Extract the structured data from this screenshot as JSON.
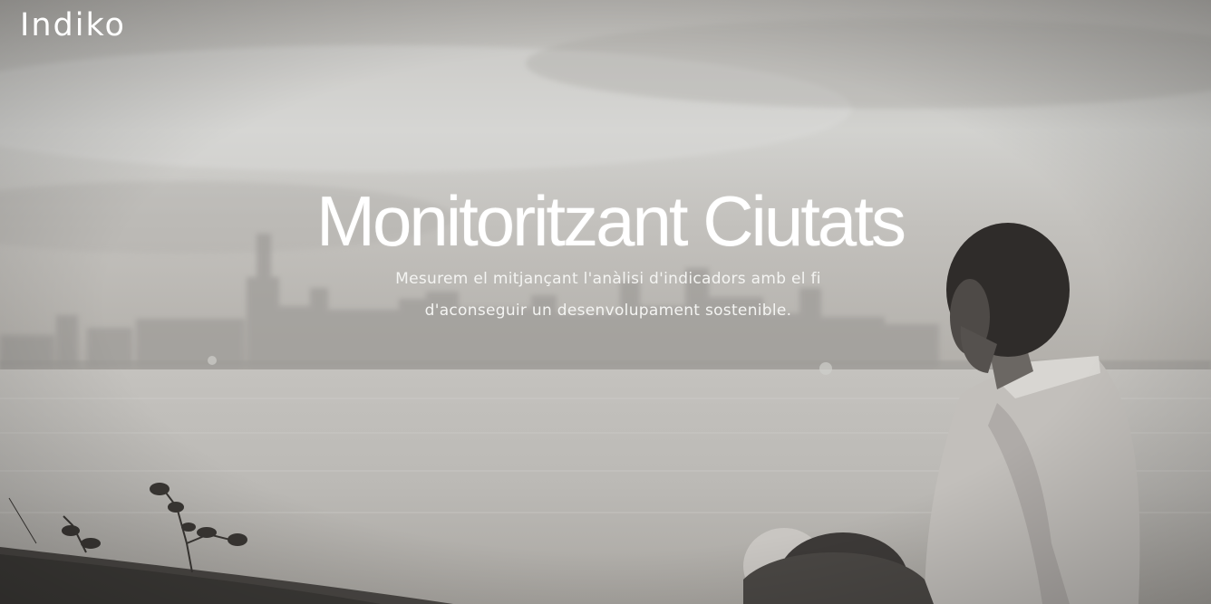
{
  "header": {
    "brand": "Indiko"
  },
  "hero": {
    "title": "Monitoritzant Ciutats",
    "subtitle": "Mesurem el mitjançant l'anàlisi d'indicadors amb el fi d'aconseguir un desenvolupament sostenible."
  },
  "colors": {
    "text": "#ffffff",
    "sky": "#c9c8c4",
    "water": "#b8b6b2",
    "figure": "#3b3835"
  },
  "icons": {
    "background": "lakefront-city-skyline-photo"
  }
}
